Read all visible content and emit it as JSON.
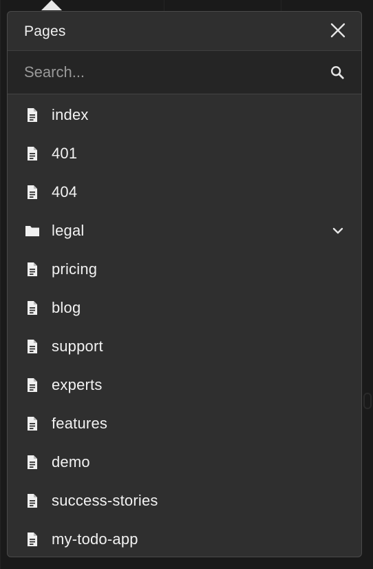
{
  "panel": {
    "title": "Pages",
    "close_icon": "close-icon"
  },
  "search": {
    "placeholder": "Search...",
    "value": "",
    "icon": "search-icon"
  },
  "pages": [
    {
      "label": "index",
      "icon": "file-icon"
    },
    {
      "label": "401",
      "icon": "file-icon"
    },
    {
      "label": "404",
      "icon": "file-icon"
    },
    {
      "label": "legal",
      "icon": "folder-icon",
      "expandable": true
    },
    {
      "label": "pricing",
      "icon": "file-icon"
    },
    {
      "label": "blog",
      "icon": "file-icon"
    },
    {
      "label": "support",
      "icon": "file-icon"
    },
    {
      "label": "experts",
      "icon": "file-icon"
    },
    {
      "label": "features",
      "icon": "file-icon"
    },
    {
      "label": "demo",
      "icon": "file-icon"
    },
    {
      "label": "success-stories",
      "icon": "file-icon"
    },
    {
      "label": "my-todo-app",
      "icon": "file-icon"
    }
  ],
  "colors": {
    "panel_bg": "#2f2f2f",
    "search_bg": "#252525",
    "text": "#f2f2f2",
    "placeholder": "#9a9a9a",
    "background": "#1a1a1a"
  }
}
